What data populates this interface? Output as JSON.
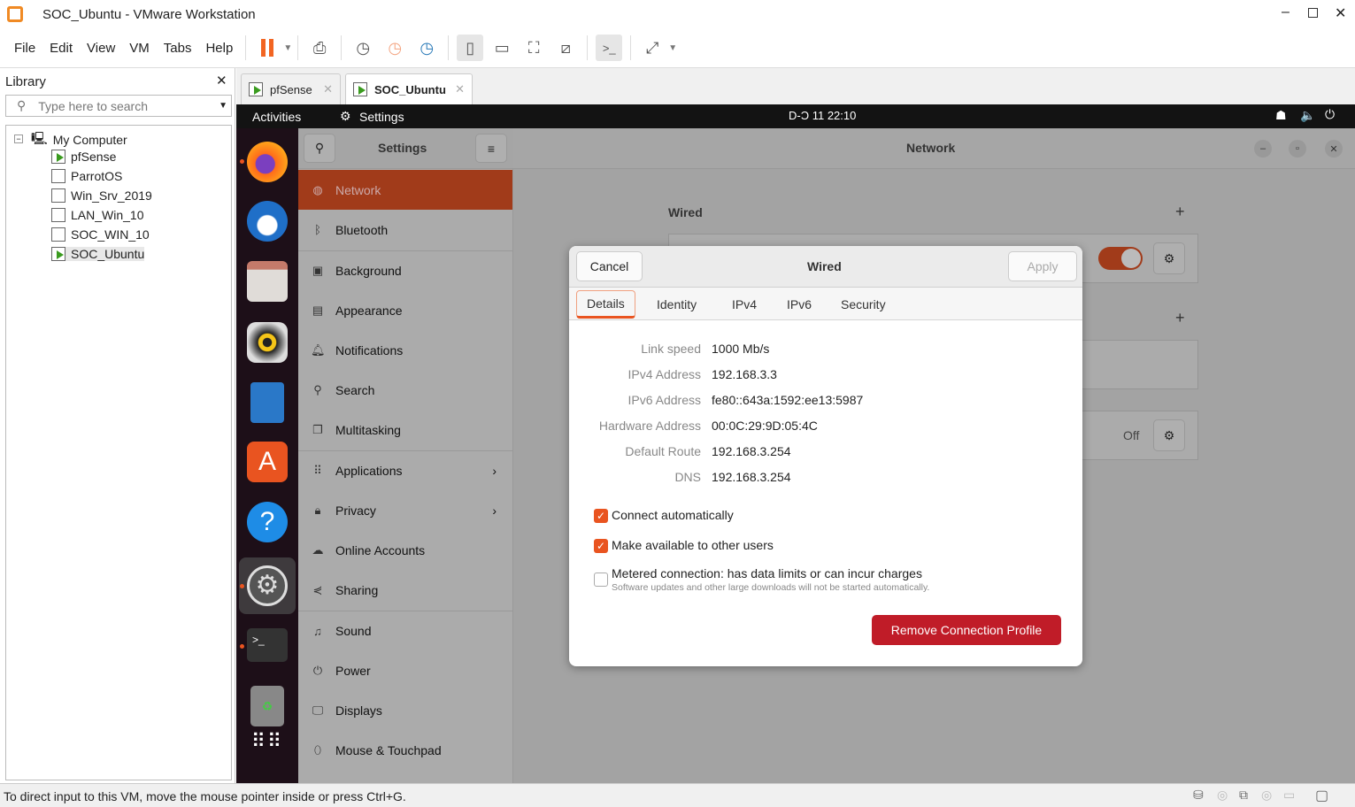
{
  "window": {
    "title": "SOC_Ubuntu - VMware Workstation"
  },
  "menu": [
    "File",
    "Edit",
    "View",
    "VM",
    "Tabs",
    "Help"
  ],
  "library": {
    "title": "Library",
    "search_placeholder": "Type here to search",
    "root": "My Computer",
    "vms": [
      "pfSense",
      "ParrotOS",
      "Win_Srv_2019",
      "LAN_Win_10",
      "SOC_WIN_10",
      "SOC_Ubuntu"
    ]
  },
  "tabs": [
    {
      "label": "pfSense"
    },
    {
      "label": "SOC_Ubuntu"
    }
  ],
  "topbar": {
    "activities": "Activities",
    "app": "Settings",
    "clock": "D-Ͻ 11  22:10"
  },
  "settings": {
    "title": "Settings",
    "items": [
      "Network",
      "Bluetooth",
      "Background",
      "Appearance",
      "Notifications",
      "Search",
      "Multitasking",
      "Applications",
      "Privacy",
      "Online Accounts",
      "Sharing",
      "Sound",
      "Power",
      "Displays",
      "Mouse & Touchpad"
    ]
  },
  "network": {
    "title": "Network",
    "wired_label": "Wired",
    "off_label": "Off"
  },
  "dialog": {
    "title": "Wired",
    "cancel": "Cancel",
    "apply": "Apply",
    "tabs": [
      "Details",
      "Identity",
      "IPv4",
      "IPv6",
      "Security"
    ],
    "details": [
      {
        "label": "Link speed",
        "value": "1000 Mb/s"
      },
      {
        "label": "IPv4 Address",
        "value": "192.168.3.3"
      },
      {
        "label": "IPv6 Address",
        "value": "fe80::643a:1592:ee13:5987"
      },
      {
        "label": "Hardware Address",
        "value": "00:0C:29:9D:05:4C"
      },
      {
        "label": "Default Route",
        "value": "192.168.3.254"
      },
      {
        "label": "DNS",
        "value": "192.168.3.254"
      }
    ],
    "connect_auto": "Connect automatically",
    "available_all": "Make available to other users",
    "metered": "Metered connection: has data limits or can incur charges",
    "metered_hint": "Software updates and other large downloads will not be started automatically.",
    "remove": "Remove Connection Profile"
  },
  "status": {
    "text": "To direct input to this VM, move the mouse pointer inside or press Ctrl+G."
  },
  "colors": {
    "accent": "#e95420",
    "remove": "#c01c28",
    "selected": "#a13b1a"
  }
}
